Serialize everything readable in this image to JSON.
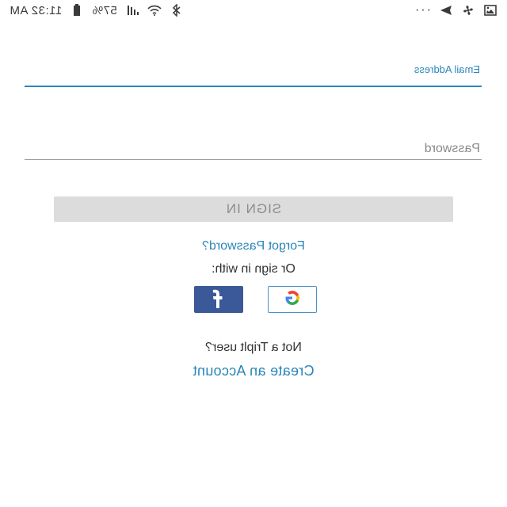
{
  "status_bar": {
    "time": "11:32 AM",
    "battery": "57%",
    "overflow": "···",
    "icons": [
      "gallery-icon",
      "fan-icon",
      "send-icon",
      "bluetooth-icon",
      "wifi-icon",
      "signal-icon",
      "battery-icon"
    ]
  },
  "form": {
    "email": {
      "label": "Email Address",
      "value": ""
    },
    "password": {
      "placeholder": "Password",
      "value": ""
    },
    "sign_in_label": "SIGN IN"
  },
  "links": {
    "forgot": "Forgot Password?",
    "or_sign_in": "Or sign in with:",
    "not_user": "Not a Triplt user?",
    "create_account": "Create an Account"
  },
  "social": {
    "google": "google-icon",
    "facebook": "facebook-icon"
  },
  "colors": {
    "accent": "#2b86b8",
    "facebook": "#3b5998",
    "button_disabled": "#dcdcdc"
  }
}
